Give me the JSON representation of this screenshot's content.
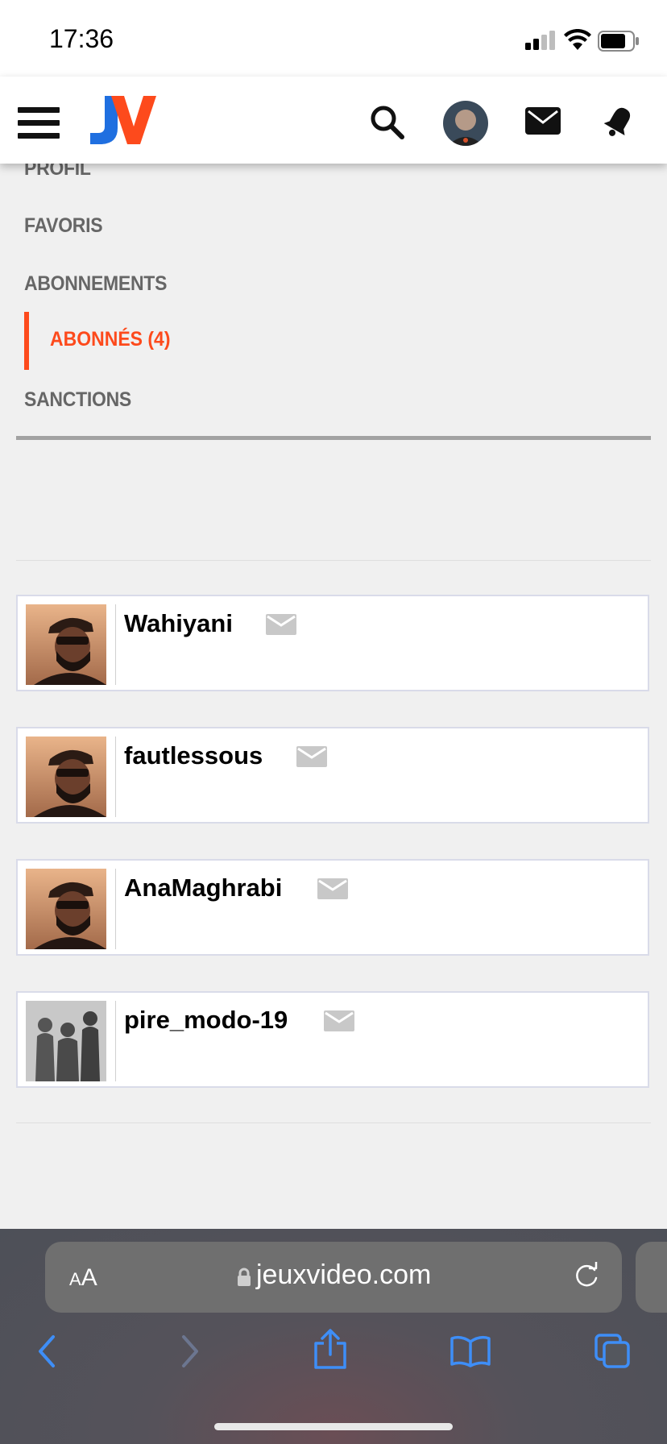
{
  "status_bar": {
    "time": "17:36"
  },
  "header": {
    "logo_text": "JV",
    "colors": {
      "logo_j": "#1f6fe0",
      "logo_v": "#fd4a1c"
    }
  },
  "menu": {
    "items": [
      {
        "label": "PROFIL"
      },
      {
        "label": "FAVORIS"
      },
      {
        "label": "ABONNEMENTS"
      },
      {
        "label": "ABONNÉS (4)",
        "active": true
      },
      {
        "label": "SANCTIONS"
      }
    ],
    "accent_color": "#fd4a1c"
  },
  "followers": [
    {
      "username": "Wahiyani",
      "avatar": "man-with-cap-photo"
    },
    {
      "username": "fautlessous",
      "avatar": "man-with-cap-photo"
    },
    {
      "username": "AnaMaghrabi",
      "avatar": "man-with-cap-photo"
    },
    {
      "username": "pire_modo-19",
      "avatar": "three-silhouettes-photo"
    }
  ],
  "browser": {
    "text_size_label_small": "A",
    "text_size_label_large": "A",
    "url": "jeuxvideo.com"
  }
}
